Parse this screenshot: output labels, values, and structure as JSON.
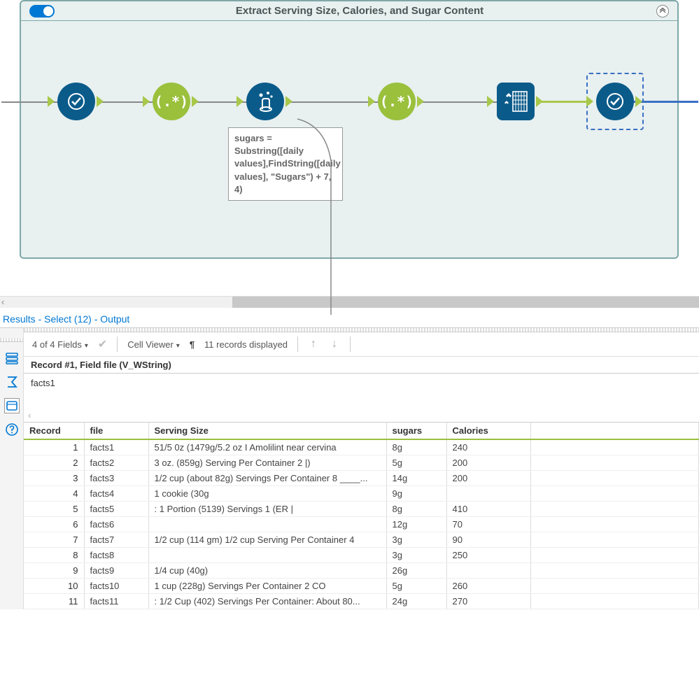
{
  "container": {
    "title": "Extract Serving Size, Calories, and Sugar Content"
  },
  "annotation": {
    "text": "sugars = Substring([daily values],FindString([daily values], \"Sugars\") + 7, 4)"
  },
  "results": {
    "tab_label": "Results - Select (12) - Output",
    "fields_label": "4 of 4 Fields",
    "cell_viewer_label": "Cell Viewer",
    "records_displayed": "11 records displayed",
    "record_header": "Record #1, Field file (V_WString)",
    "cell_value": "facts1"
  },
  "table": {
    "headers": {
      "record": "Record",
      "file": "file",
      "serving": "Serving Size",
      "sugars": "sugars",
      "calories": "Calories"
    },
    "rows": [
      {
        "n": "1",
        "file": "facts1",
        "serving": "51/5 0z (1479g/5.2 oz I Amolilint near cervina",
        "sugars": "8g",
        "calories": "240"
      },
      {
        "n": "2",
        "file": "facts2",
        "serving": "3 oz. (859g) Serving Per Container 2 |)",
        "sugars": "5g",
        "calories": "200"
      },
      {
        "n": "3",
        "file": "facts3",
        "serving": "1/2 cup (about 82g) Servings Per Container 8 ____...",
        "sugars": "14g",
        "calories": "200"
      },
      {
        "n": "4",
        "file": "facts4",
        "serving": "1 cookie (30g",
        "sugars": "9g",
        "calories": ""
      },
      {
        "n": "5",
        "file": "facts5",
        "serving": ": 1 Portion (5139) Servings 1 (ER |",
        "sugars": "8g",
        "calories": "410"
      },
      {
        "n": "6",
        "file": "facts6",
        "serving": "",
        "sugars": "12g",
        "calories": "70"
      },
      {
        "n": "7",
        "file": "facts7",
        "serving": "1/2 cup (114 gm) 1/2 cup Serving Per Container 4",
        "sugars": "3g",
        "calories": "90"
      },
      {
        "n": "8",
        "file": "facts8",
        "serving": "",
        "sugars": "3g",
        "calories": "250"
      },
      {
        "n": "9",
        "file": "facts9",
        "serving": "1/4 cup (40g)",
        "sugars": "26g",
        "calories": ""
      },
      {
        "n": "10",
        "file": "facts10",
        "serving": "1 cup (228g) Servings Per Container 2 CO",
        "sugars": "5g",
        "calories": "260"
      },
      {
        "n": "11",
        "file": "facts11",
        "serving": ": 1/2 Cup (402) Servings Per Container: About 80...",
        "sugars": "24g",
        "calories": "270"
      }
    ]
  }
}
